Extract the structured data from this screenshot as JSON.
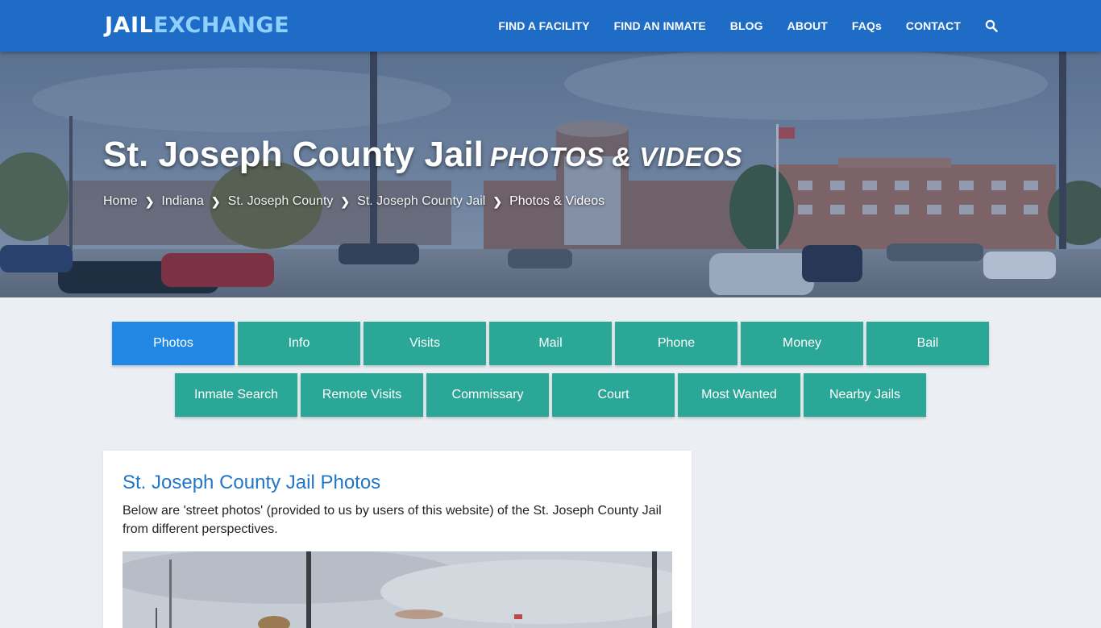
{
  "header": {
    "logo_part1": "JAIL",
    "logo_part2": "EXCHANGE",
    "nav": [
      "FIND A FACILITY",
      "FIND AN INMATE",
      "BLOG",
      "ABOUT",
      "FAQs",
      "CONTACT"
    ],
    "search_icon": "search-icon"
  },
  "hero": {
    "title": "St. Joseph County Jail",
    "subtitle": "PHOTOS & VIDEOS",
    "breadcrumbs": [
      "Home",
      "Indiana",
      "St. Joseph County",
      "St. Joseph County Jail",
      "Photos & Videos"
    ]
  },
  "tabs": {
    "row1": [
      "Photos",
      "Info",
      "Visits",
      "Mail",
      "Phone",
      "Money",
      "Bail"
    ],
    "row2": [
      "Inmate Search",
      "Remote Visits",
      "Commissary",
      "Court",
      "Most Wanted",
      "Nearby Jails"
    ],
    "active": "Photos"
  },
  "content": {
    "heading": "St. Joseph County Jail Photos",
    "description": "Below are 'street photos' (provided to us by users of this website) of the St. Joseph County Jail from different perspectives."
  },
  "colors": {
    "header_bg": "#1f6cc7",
    "logo_accent": "#8fd0ff",
    "tab_bg": "#2aa797",
    "tab_active_bg": "#2288e6",
    "heading_color": "#2176c7",
    "page_bg": "#ebeef2"
  }
}
